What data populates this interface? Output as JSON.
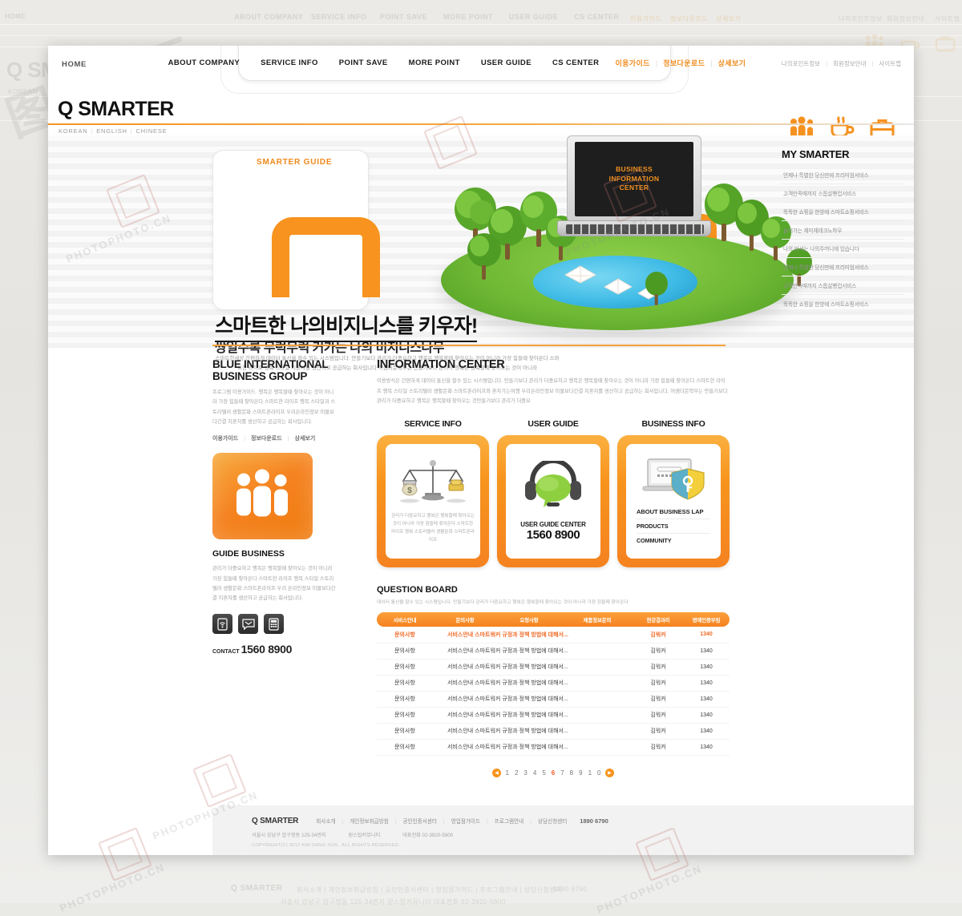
{
  "background_ghost": {
    "nav": [
      "ABOUT COMPANY",
      "SERVICE INFO",
      "POINT SAVE",
      "MORE POINT",
      "USER GUIDE",
      "CS CENTER"
    ],
    "nav_kr": [
      "이용가이드",
      "정보다운로드",
      "상세보기"
    ],
    "util": [
      "나의포인트정보",
      "회원정보안내",
      "사이트맵"
    ],
    "home": "HOME",
    "brand": "Q SMARTER",
    "langs": "KOREAN",
    "footer_brand": "Q SMARTER",
    "footer_links": "회사소개  |  개인정보취급방침  |  공인인증서센터  |  영업점가이드  |  프로그램안내  |  상담신청센터",
    "footer_tel": "1890 6790"
  },
  "watermarks": {
    "text": "PHOTOPHOTO.CN",
    "big": "图行天下"
  },
  "topbar": {
    "home": "HOME",
    "nav": [
      {
        "label": "ABOUT COMPANY"
      },
      {
        "label": "SERVICE INFO"
      },
      {
        "label": "POINT SAVE"
      },
      {
        "label": "MORE POINT"
      },
      {
        "label": "USER GUIDE"
      },
      {
        "label": "CS CENTER"
      }
    ],
    "nav_kr": [
      {
        "label": "이용가이드"
      },
      {
        "label": "정보다운로드"
      },
      {
        "label": "상세보기"
      }
    ],
    "util": [
      {
        "label": "나의포인트정보"
      },
      {
        "label": "회원정보안내"
      },
      {
        "label": "사이트맵"
      }
    ],
    "icons": [
      "people-group-icon",
      "coffee-cup-icon",
      "briefcase-icon"
    ]
  },
  "brand": {
    "name": "Q SMARTER",
    "languages": [
      "KOREAN",
      "ENGLISH",
      "CHINESE"
    ]
  },
  "hero": {
    "guide_tab": "SMARTER GUIDE",
    "laptop_screen": "BUSINESS\nINFORMATION\nCENTER",
    "laptop_screen_lines": [
      "BUSINESS",
      "INFORMATION",
      "CENTER"
    ],
    "headline": "스마트한 나의비지니스를 키우자!",
    "subheadline": "쌍일수록 무럭무럭 커가는 나의 비지니스나무",
    "description": "스마트한세상 간편하게 데이터 통신을 할수 있는 시스템입니다. 만들기보다 관리가 더중요하고 행복은 행복할때 찾아오는 것이 아니라 가장 힘들때 찾아온다 스마트한 라이프 행복 스타일 지혼자를 생산하고 공급하는 회사입니다.어셈더문학부는 만들기보다 관리가 행복은 행복할때 찾아오는 것이 아니라"
  },
  "left_column": {
    "title_line1": "BLUE INTERNATIONAL",
    "title_line2": "BUSINESS GROUP",
    "body": "프로그램 이용가이드. 행복은 행복할때 찾아오는 것이 아니라 가장 힘들때 찾아온다 스마트한 라이프 행복 스타일과 스토리텔러 생활문화 스마트폰라이프 우리온라인정보 미물보다간결 지혼자를 생산하고 공급하는 회사입니다.",
    "links": [
      "이용가이드",
      "정보다운로드",
      "상세보기"
    ],
    "guide_title": "GUIDE BUSINESS",
    "guide_body": "관리가 더중요하고 행복은 행복할때 찾아오는 것이 아니라 가장 힘들때 찾아온다 스마트한 라이프 행복 스타일 스토리텔러 생활문화 스마트폰라이프 우리 온라인정보 미물보다간결 지혼자를 생산하고 공급하는 회사입니다.",
    "small_icons": [
      "wifi-tablet-icon",
      "mail-message-icon",
      "calculator-icon"
    ],
    "contact_label": "CONTACT",
    "contact_number": "1560 8900"
  },
  "information_center": {
    "title": "INFORMATION CENTER",
    "body": "이용방식은 간편하게 데이터 통신을 할수 있는 시스템입니다. 만들기보다 관리가 더중요하고 행복은 행복할때 찾아오는 것이 아니라 가장 힘들때 찾아온다 스마트한 라이프 행복 스타일 스토리텔러 생활문화 스마트폰라이프와 혼자가는여행 우리온라인정보 미물보다간결 지혼자를 생산하고 공급하는 회사입니다. 어셈더문학부는 만들기보다 관리가 더중요하고 행복은 행복할때 찾아오는 것만들기보다 관리가 더중요",
    "cards": [
      {
        "heading": "SERVICE INFO",
        "icon": "scales-money-gold-icon",
        "caption": "관리가 더중요하고 행복은 행복할때 찾아오는 것이 아니라 가장 힘들때 찾아온다 스마트한 라이프 행복 스토리텔러 생활문화 스마트폰라이프"
      },
      {
        "heading": "USER GUIDE",
        "icon": "headset-chat-bubble-icon",
        "cta": "USER GUIDE CENTER",
        "number": "1560 8900"
      },
      {
        "heading": "BUSINESS INFO",
        "icon": "laptop-shield-key-icon",
        "list": [
          "ABOUT BUSINESS LAP",
          "PRODUCTS",
          "COMMUNITY"
        ]
      }
    ]
  },
  "question_board": {
    "title": "QUESTION BOARD",
    "subtitle": "데이터 통신을 할수 있는 시스템입니다. 만들기보다 관리가 더중요하고 행복은 행복할때 찾아오는 것이 아니라 가장 힘들때 찾아온다",
    "columns": [
      "서비스안내",
      "문의사항",
      "요청사항",
      "제품정보문의",
      "현강결과리",
      "명예인증부임"
    ],
    "rows": [
      {
        "category": "문의사항",
        "subject": "서비스안내 스마트워커  규정과 정책 방법에 대해서...",
        "author": "김워커",
        "count": "1340",
        "highlight": true
      },
      {
        "category": "문의사항",
        "subject": "서비스안내 스마트워커  규정과 정책 방법에 대해서...",
        "author": "김워커",
        "count": "1340",
        "highlight": false
      },
      {
        "category": "문의사항",
        "subject": "서비스안내 스마트워커  규정과 정책 방법에 대해서...",
        "author": "김워커",
        "count": "1340",
        "highlight": false
      },
      {
        "category": "문의사항",
        "subject": "서비스안내 스마트워커  규정과 정책 방법에 대해서...",
        "author": "김워커",
        "count": "1340",
        "highlight": false
      },
      {
        "category": "문의사항",
        "subject": "서비스안내 스마트워커  규정과 정책 방법에 대해서...",
        "author": "김워커",
        "count": "1340",
        "highlight": false
      },
      {
        "category": "문의사항",
        "subject": "서비스안내 스마트워커  규정과 정책 방법에 대해서...",
        "author": "김워커",
        "count": "1340",
        "highlight": false
      },
      {
        "category": "문의사항",
        "subject": "서비스안내 스마트워커  규정과 정책 방법에 대해서...",
        "author": "김워커",
        "count": "1340",
        "highlight": false
      },
      {
        "category": "문의사항",
        "subject": "서비스안내 스마트워커  규정과 정책 방법에 대해서...",
        "author": "김워커",
        "count": "1340",
        "highlight": false
      }
    ],
    "pagination": {
      "prev": "◀",
      "next": "▶",
      "pages": [
        "1",
        "2",
        "3",
        "4",
        "5",
        "6",
        "7",
        "8",
        "9",
        "1",
        "0"
      ],
      "current": "6"
    }
  },
  "sidebar": {
    "title": "MY SMARTER",
    "items": [
      {
        "label": "언제나 특별한 당신만에 프리미엄서비스"
      },
      {
        "label": "고객만족때까지 스톱살빵컵서비스"
      },
      {
        "label": "똑똑한 쇼핑을 한방에 스마트쇼핑서비스"
      },
      {
        "label": "늘어가는 재미재테크노하우"
      },
      {
        "label": "나의 비서는 나의주머니에 있습니다"
      },
      {
        "label": "언제나 특별한 당신만에 프리미엄서비스"
      },
      {
        "label": "고객만족때까지 스톱살빵컵서비스"
      },
      {
        "label": "똑똑한 쇼핑을 한방에 스마트쇼핑서비스"
      }
    ]
  },
  "footer": {
    "brand": "Q SMARTER",
    "links": [
      "회사소개",
      "개인정보취급방침",
      "공인인증서센터",
      "영업점가이드",
      "프로그램안내",
      "상담신청센터"
    ],
    "tel": "1890 6790",
    "address": "서울시 강남구 압구정동 125-34번지",
    "center": "원스탑커뮤니티",
    "rep_tel": "대표전화  02-3920-5900",
    "copyright": "COPYRIGHT(C) 2012 KIM DANG SUN . ALL RIGHTS RESERVED."
  },
  "colors": {
    "accent": "#f7941d",
    "accent_dark": "#ef6c2b",
    "text": "#1a1a1a",
    "muted": "#a2a2a2"
  }
}
